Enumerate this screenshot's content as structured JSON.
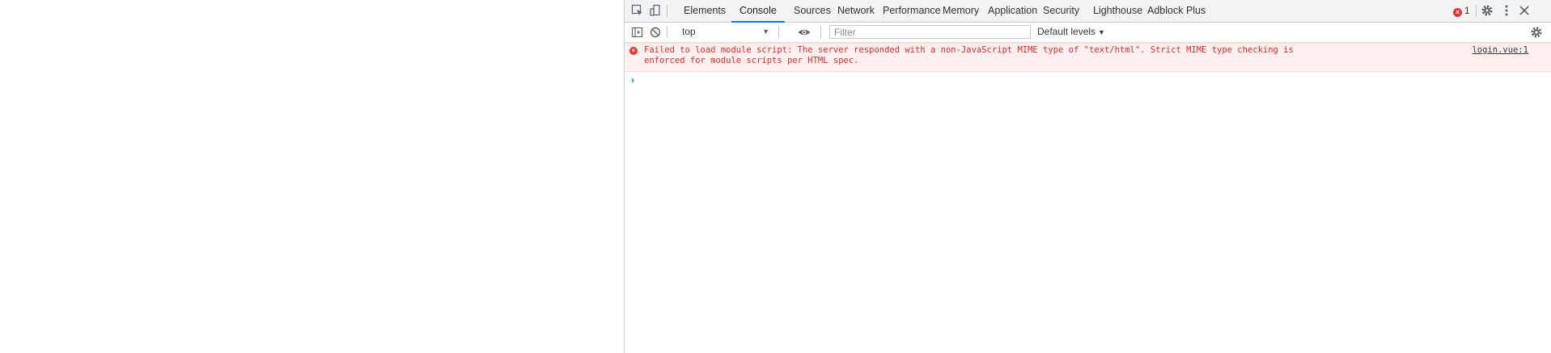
{
  "devtools": {
    "tabs": [
      "Elements",
      "Console",
      "Sources",
      "Network",
      "Performance",
      "Memory",
      "Application",
      "Security",
      "Lighthouse",
      "Adblock Plus"
    ],
    "selected_tab": "Console",
    "error_count": "1",
    "icons": {
      "inspect": "inspect-element-icon",
      "device": "device-toolbar-icon",
      "settings": "gear-icon",
      "more": "more-vert-icon",
      "close": "close-icon"
    }
  },
  "toolbar": {
    "context": "top",
    "filter_placeholder": "Filter",
    "filter_value": "",
    "levels": "Default levels"
  },
  "console": {
    "messages": [
      {
        "level": "error",
        "text": "Failed to load module script: The server responded with a non-JavaScript MIME type of \"text/html\". Strict MIME type checking is enforced for module scripts per HTML spec.",
        "source": "login.vue:1"
      }
    ]
  },
  "colors": {
    "accent": "#1a73e8",
    "error": "#e8332e",
    "error_bg": "#fff0f0"
  }
}
